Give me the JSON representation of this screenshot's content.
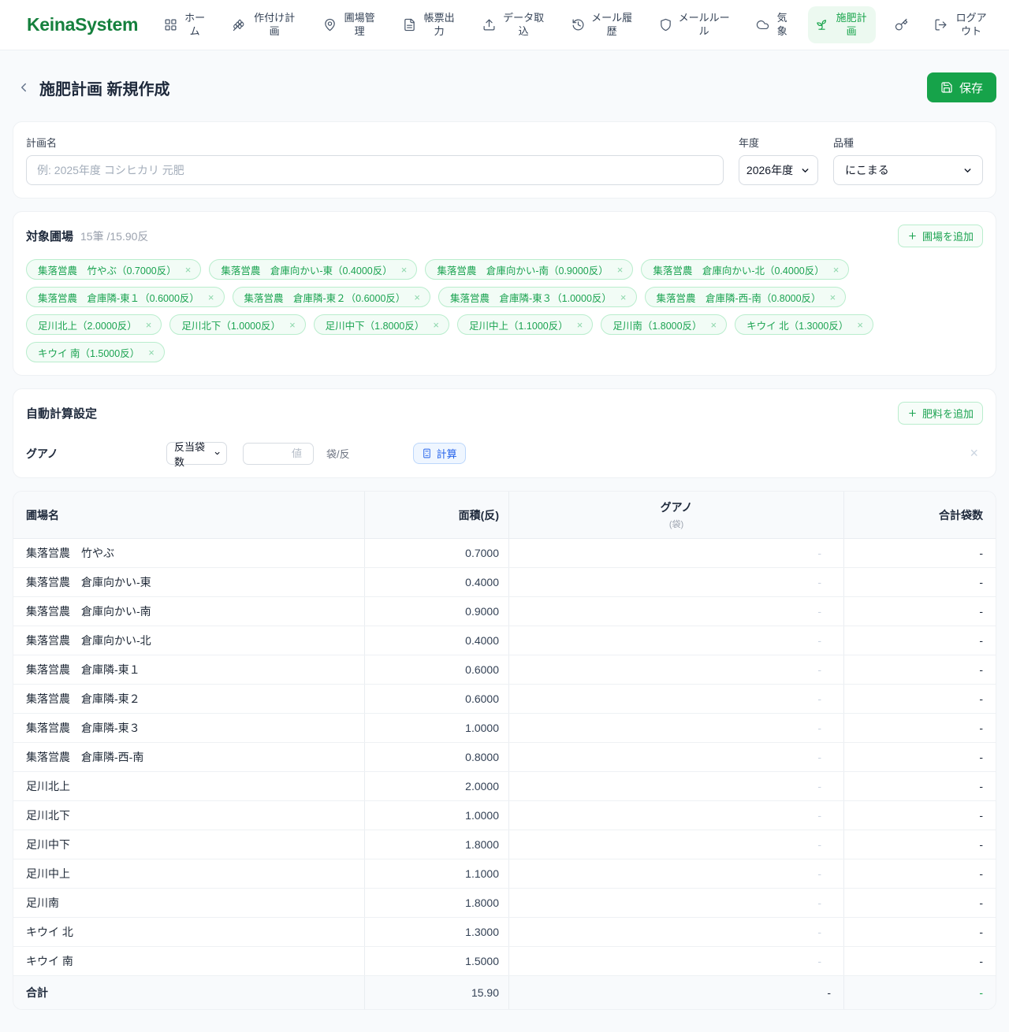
{
  "colors": {
    "accent_green": "#16a34a",
    "logo_green": "#15803d",
    "chip_bg": "#f2fcf6",
    "chip_border": "#b9edcd",
    "calc_blue": "#2563eb",
    "calc_blue_bg": "#eff6ff"
  },
  "nav": {
    "logo": "KeinaSystem",
    "items": [
      {
        "label": "ホーム",
        "icon": "grid-icon"
      },
      {
        "label": "作付け計画",
        "icon": "wheat-icon"
      },
      {
        "label": "圃場管理",
        "icon": "map-pin-icon"
      },
      {
        "label": "帳票出力",
        "icon": "file-text-icon"
      },
      {
        "label": "データ取込",
        "icon": "upload-icon"
      },
      {
        "label": "メール履歴",
        "icon": "history-icon"
      },
      {
        "label": "メールルール",
        "icon": "shield-icon"
      },
      {
        "label": "気象",
        "icon": "cloud-icon"
      },
      {
        "label": "施肥計画",
        "icon": "sprout-icon",
        "active": true
      },
      {
        "label": "",
        "icon": "key-icon"
      },
      {
        "label": "ログアウト",
        "icon": "logout-icon"
      }
    ]
  },
  "header": {
    "title": "施肥計画 新規作成",
    "save_label": "保存"
  },
  "plan_form": {
    "name_label": "計画名",
    "name_placeholder": "例: 2025年度 コシヒカリ 元肥",
    "year_label": "年度",
    "year_value": "2026年度",
    "variety_label": "品種",
    "variety_value": "にこまる"
  },
  "target_fields": {
    "title": "対象圃場",
    "summary": "15筆 /15.90反",
    "add_button_label": "圃場を追加",
    "chips": [
      "集落営農　竹やぶ（0.7000反）",
      "集落営農　倉庫向かい-東（0.4000反）",
      "集落営農　倉庫向かい-南（0.9000反）",
      "集落営農　倉庫向かい-北（0.4000反）",
      "集落営農　倉庫隣-東１（0.6000反）",
      "集落営農　倉庫隣-東２（0.6000反）",
      "集落営農　倉庫隣-東３（1.0000反）",
      "集落営農　倉庫隣-西-南（0.8000反）",
      "足川北上（2.0000反）",
      "足川北下（1.0000反）",
      "足川中下（1.8000反）",
      "足川中上（1.1000反）",
      "足川南（1.8000反）",
      "キウイ 北（1.3000反）",
      "キウイ 南（1.5000反）"
    ]
  },
  "auto_calc": {
    "title": "自動計算設定",
    "add_button_label": "肥料を追加",
    "fertilizer_name": "グアノ",
    "mode_value": "反当袋数",
    "value_placeholder": "値",
    "unit": "袋/反",
    "calc_button_label": "計算"
  },
  "table": {
    "headers": {
      "field": "圃場名",
      "area": "面積(反)",
      "fertilizer": "グアノ",
      "fertilizer_unit": "(袋)",
      "total": "合計袋数"
    },
    "rows": [
      {
        "name": "集落営農　竹やぶ",
        "area": "0.7000",
        "guano": "-",
        "total": "-"
      },
      {
        "name": "集落営農　倉庫向かい-東",
        "area": "0.4000",
        "guano": "-",
        "total": "-"
      },
      {
        "name": "集落営農　倉庫向かい-南",
        "area": "0.9000",
        "guano": "-",
        "total": "-"
      },
      {
        "name": "集落営農　倉庫向かい-北",
        "area": "0.4000",
        "guano": "-",
        "total": "-"
      },
      {
        "name": "集落営農　倉庫隣-東１",
        "area": "0.6000",
        "guano": "-",
        "total": "-"
      },
      {
        "name": "集落営農　倉庫隣-東２",
        "area": "0.6000",
        "guano": "-",
        "total": "-"
      },
      {
        "name": "集落営農　倉庫隣-東３",
        "area": "1.0000",
        "guano": "-",
        "total": "-"
      },
      {
        "name": "集落営農　倉庫隣-西-南",
        "area": "0.8000",
        "guano": "-",
        "total": "-"
      },
      {
        "name": "足川北上",
        "area": "2.0000",
        "guano": "-",
        "total": "-"
      },
      {
        "name": "足川北下",
        "area": "1.0000",
        "guano": "-",
        "total": "-"
      },
      {
        "name": "足川中下",
        "area": "1.8000",
        "guano": "-",
        "total": "-"
      },
      {
        "name": "足川中上",
        "area": "1.1000",
        "guano": "-",
        "total": "-"
      },
      {
        "name": "足川南",
        "area": "1.8000",
        "guano": "-",
        "total": "-"
      },
      {
        "name": "キウイ 北",
        "area": "1.3000",
        "guano": "-",
        "total": "-"
      },
      {
        "name": "キウイ 南",
        "area": "1.5000",
        "guano": "-",
        "total": "-"
      }
    ],
    "total_row": {
      "label": "合計",
      "area": "15.90",
      "guano": "-",
      "total": "-"
    }
  }
}
